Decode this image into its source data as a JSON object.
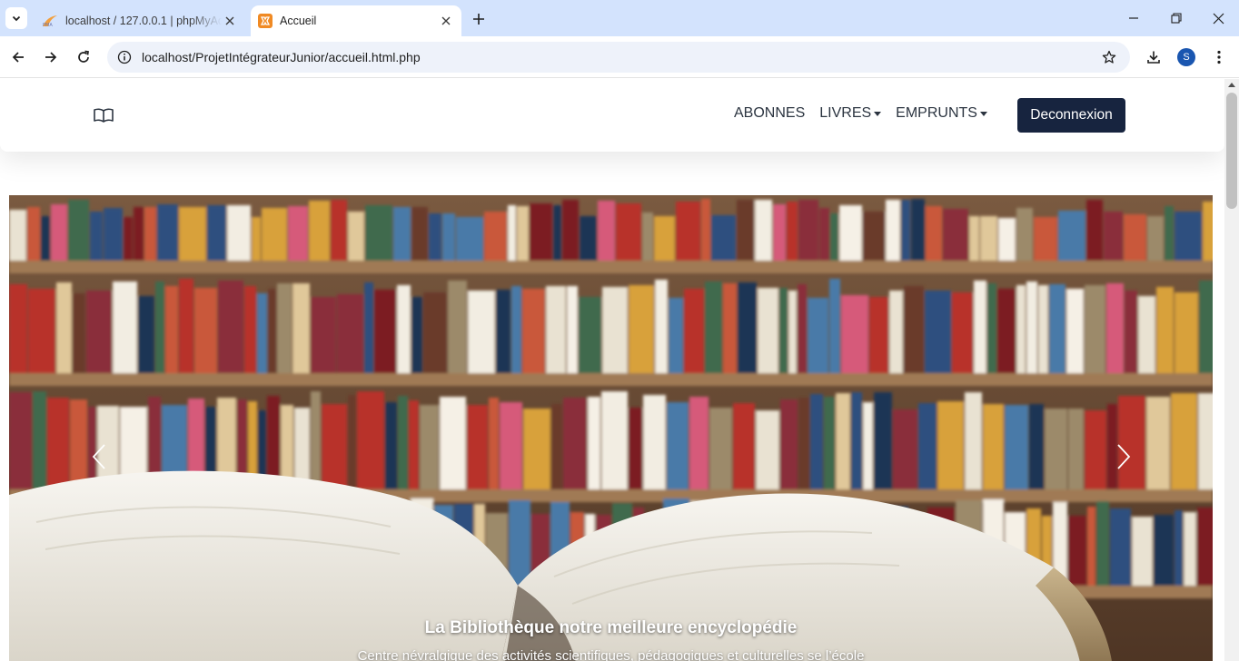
{
  "browser": {
    "tabs": [
      {
        "title": "localhost / 127.0.0.1 | phpMyAdmin",
        "favicon": "phpmyadmin-icon",
        "active": false
      },
      {
        "title": "Accueil",
        "favicon": "xampp-icon",
        "active": true
      }
    ],
    "url": "localhost/ProjetIntégrateurJunior/accueil.html.php",
    "profile_initial": "S",
    "colors": {
      "tabbar": "#d3e3fd",
      "omnibox": "#eef2fa",
      "avatar": "#1a56b0"
    }
  },
  "site": {
    "brand_icon": "open-book-icon",
    "nav": [
      {
        "label": "ABONNES",
        "dropdown": false
      },
      {
        "label": "LIVRES",
        "dropdown": true
      },
      {
        "label": "EMPRUNTS",
        "dropdown": true
      }
    ],
    "logout_label": "Deconnexion",
    "colors": {
      "logout_button": "#17243f",
      "nav_text": "#2b3440"
    }
  },
  "carousel": {
    "caption_title": "La Bibliothèque notre meilleure encyclopédie",
    "caption_text": "Centre névralgique des activités scientifiques, pédagogiques et culturelles se l’école"
  }
}
